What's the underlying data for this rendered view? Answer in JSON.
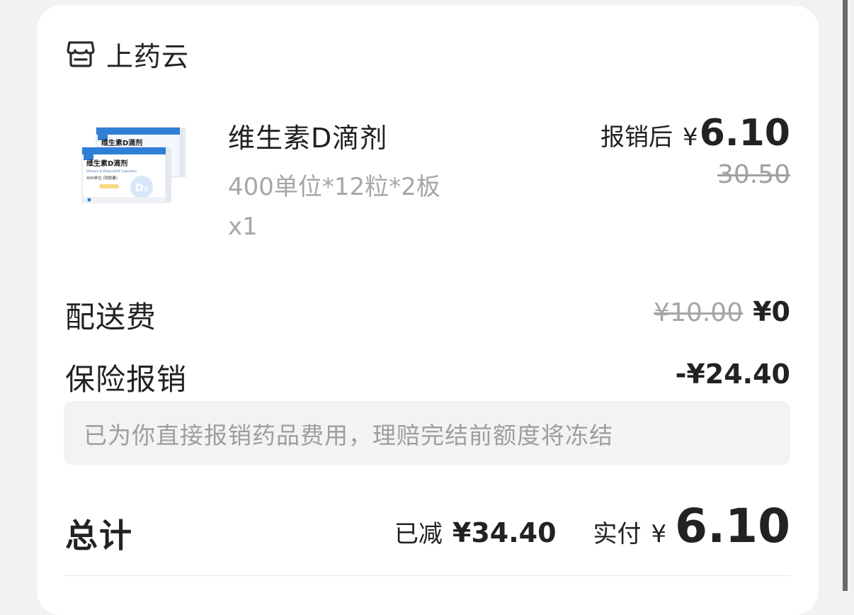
{
  "store": {
    "name": "上药云",
    "icon": "store-icon"
  },
  "product": {
    "name": "维生素D滴剂",
    "spec": "400单位*12粒*2板",
    "quantity": "x1",
    "price_after_label": "报销后",
    "price_after_currency": "¥",
    "price_after_amount": "6.10",
    "original_price": "30.50",
    "image": {
      "box_title": "维生素D滴剂",
      "box_subtitle": "Vitamin D Drops(Soft Capsules)",
      "box_dose": "400单位 (软胶囊)",
      "badge": "D₃"
    }
  },
  "delivery": {
    "label": "配送费",
    "original": "¥10.00",
    "current": "¥0"
  },
  "insurance": {
    "label": "保险报销",
    "amount": "-¥24.40",
    "notice": "已为你直接报销药品费用，理赔完结前额度将冻结"
  },
  "total": {
    "label": "总计",
    "reduced_label": "已减",
    "reduced_amount": "¥34.40",
    "paid_label": "实付",
    "paid_currency": "¥",
    "paid_amount": "6.10"
  },
  "colors": {
    "text_primary": "#222222",
    "text_secondary": "#a6a6a6",
    "notice_bg": "#f3f3f3",
    "card_bg": "#ffffff",
    "page_bg": "#f2f2f2",
    "box_blue": "#2f7fd6"
  }
}
